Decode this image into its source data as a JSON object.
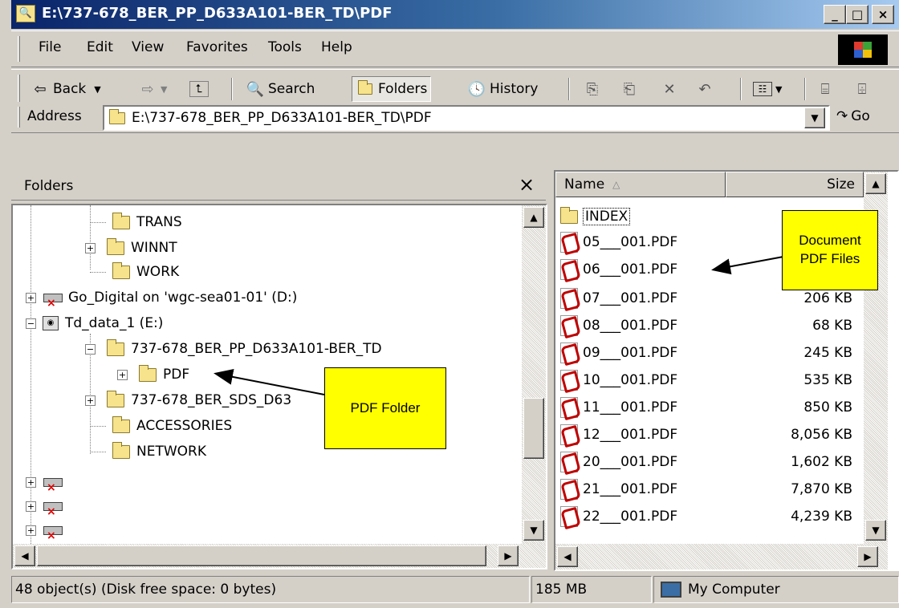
{
  "window": {
    "title": "E:\\737-678_BER_PP_D633A101-BER_TD\\PDF",
    "min": "_",
    "max": "□",
    "close": "×"
  },
  "menu": [
    "File",
    "Edit",
    "View",
    "Favorites",
    "Tools",
    "Help"
  ],
  "toolbar": {
    "back": "Back",
    "search": "Search",
    "folders": "Folders",
    "history": "History"
  },
  "address": {
    "label": "Address",
    "value": "E:\\737-678_BER_PP_D633A101-BER_TD\\PDF",
    "go": "Go"
  },
  "folders_pane": {
    "title": "Folders",
    "close": "×",
    "items": [
      {
        "label": "TRANS"
      },
      {
        "label": "WINNT"
      },
      {
        "label": "WORK"
      },
      {
        "label": "Go_Digital on 'wgc-sea01-01' (D:)"
      },
      {
        "label": "Td_data_1 (E:)"
      },
      {
        "label": "737-678_BER_PP_D633A101-BER_TD"
      },
      {
        "label": "PDF"
      },
      {
        "label": "737-678_BER_SDS_D63"
      },
      {
        "label": "ACCESSORIES"
      },
      {
        "label": "NETWORK"
      }
    ]
  },
  "file_list": {
    "col_name": "Name",
    "col_size": "Size",
    "files": [
      {
        "name": "INDEX",
        "size": ""
      },
      {
        "name": "05___001.PDF",
        "size": ""
      },
      {
        "name": "06___001.PDF",
        "size": ""
      },
      {
        "name": "07___001.PDF",
        "size": "206 KB"
      },
      {
        "name": "08___001.PDF",
        "size": "68 KB"
      },
      {
        "name": "09___001.PDF",
        "size": "245 KB"
      },
      {
        "name": "10___001.PDF",
        "size": "535 KB"
      },
      {
        "name": "11___001.PDF",
        "size": "850 KB"
      },
      {
        "name": "12___001.PDF",
        "size": "8,056 KB"
      },
      {
        "name": "20___001.PDF",
        "size": "1,602 KB"
      },
      {
        "name": "21___001.PDF",
        "size": "7,870 KB"
      },
      {
        "name": "22___001.PDF",
        "size": "4,239 KB"
      }
    ]
  },
  "callouts": {
    "pdf_folder": "PDF Folder",
    "doc_files_1": "Document",
    "doc_files_2": "PDF Files"
  },
  "status": {
    "objects": "48 object(s) (Disk free space: 0 bytes)",
    "size": "185 MB",
    "zone": "My Computer"
  }
}
